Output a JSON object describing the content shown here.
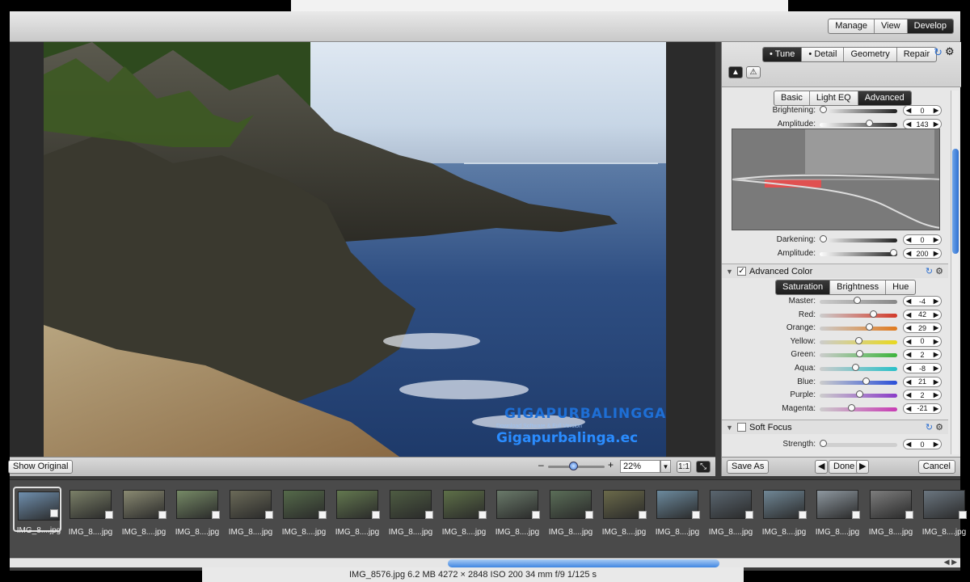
{
  "toolbar": {
    "modes": [
      {
        "label": "Manage",
        "active": false
      },
      {
        "label": "View",
        "active": false
      },
      {
        "label": "Develop",
        "active": true
      }
    ]
  },
  "panel": {
    "tabs": [
      {
        "label": "Tune",
        "active": true
      },
      {
        "label": "Detail",
        "active": false
      },
      {
        "label": "Geometry",
        "active": false
      },
      {
        "label": "Repair",
        "active": false
      }
    ],
    "tone_tabs": [
      {
        "label": "Basic",
        "active": false
      },
      {
        "label": "Light EQ",
        "active": false
      },
      {
        "label": "Advanced",
        "active": true
      }
    ],
    "light_eq": {
      "brightening": {
        "label": "Brightening:",
        "value": "0"
      },
      "amplitude_top": {
        "label": "Amplitude:",
        "value": "143"
      },
      "darkening": {
        "label": "Darkening:",
        "value": "0"
      },
      "amplitude_bottom": {
        "label": "Amplitude:",
        "value": "200"
      }
    },
    "advanced_color": {
      "title": "Advanced Color",
      "checked": true,
      "tabs": [
        {
          "label": "Saturation",
          "active": true
        },
        {
          "label": "Brightness",
          "active": false
        },
        {
          "label": "Hue",
          "active": false
        }
      ],
      "sliders": [
        {
          "label": "Master:",
          "value": "-4",
          "color": "#888888"
        },
        {
          "label": "Red:",
          "value": "42",
          "color": "#d23a2a"
        },
        {
          "label": "Orange:",
          "value": "29",
          "color": "#e07a1e"
        },
        {
          "label": "Yellow:",
          "value": "0",
          "color": "#e8d820"
        },
        {
          "label": "Green:",
          "value": "2",
          "color": "#3cb43c"
        },
        {
          "label": "Aqua:",
          "value": "-8",
          "color": "#28c0c8"
        },
        {
          "label": "Blue:",
          "value": "21",
          "color": "#2a4fd8"
        },
        {
          "label": "Purple:",
          "value": "2",
          "color": "#8a3cc8"
        },
        {
          "label": "Magenta:",
          "value": "-21",
          "color": "#c83cb4"
        }
      ]
    },
    "soft_focus": {
      "title": "Soft Focus",
      "checked": false,
      "strength": {
        "label": "Strength:",
        "value": "0"
      }
    },
    "footer": {
      "save_as": "Save As",
      "done": "Done",
      "cancel": "Cancel"
    }
  },
  "viewer": {
    "show_original": "Show Original",
    "zoom": "22%",
    "one_to_one": "1:1",
    "watermark_brand": "GIGAPURBALINGGA",
    "watermark_tagline": "Download Software & Full Version",
    "watermark_site": "Gigapurbalinga.ec"
  },
  "filmstrip": {
    "items": [
      {
        "caption": "IMG_8....jpg",
        "selected": true,
        "color": "#6f8fae"
      },
      {
        "caption": "IMG_8....jpg",
        "selected": false,
        "color": "#7b8068"
      },
      {
        "caption": "IMG_8....jpg",
        "selected": false,
        "color": "#8a8a72"
      },
      {
        "caption": "IMG_8....jpg",
        "selected": false,
        "color": "#768a66"
      },
      {
        "caption": "IMG_8....jpg",
        "selected": false,
        "color": "#6b6a58"
      },
      {
        "caption": "IMG_8....jpg",
        "selected": false,
        "color": "#556a4a"
      },
      {
        "caption": "IMG_8....jpg",
        "selected": false,
        "color": "#63784f"
      },
      {
        "caption": "IMG_8....jpg",
        "selected": false,
        "color": "#4e5c42"
      },
      {
        "caption": "IMG_8....jpg",
        "selected": false,
        "color": "#5e7048"
      },
      {
        "caption": "IMG_8....jpg",
        "selected": false,
        "color": "#6a7a6a"
      },
      {
        "caption": "IMG_8....jpg",
        "selected": false,
        "color": "#5b6e58"
      },
      {
        "caption": "IMG_8....jpg",
        "selected": false,
        "color": "#6b6a4a"
      },
      {
        "caption": "IMG_8....jpg",
        "selected": false,
        "color": "#6c8a9e"
      },
      {
        "caption": "IMG_8....jpg",
        "selected": false,
        "color": "#5a6670"
      },
      {
        "caption": "IMG_8....jpg",
        "selected": false,
        "color": "#708796"
      },
      {
        "caption": "IMG_8....jpg",
        "selected": false,
        "color": "#8e98a0"
      },
      {
        "caption": "IMG_8....jpg",
        "selected": false,
        "color": "#7d7d7d"
      },
      {
        "caption": "IMG_8....jpg",
        "selected": false,
        "color": "#6b7680"
      }
    ]
  },
  "status": {
    "text": "IMG_8576.jpg  6.2 MB  4272 × 2848  ISO 200  34 mm  f/9  1/125 s"
  }
}
